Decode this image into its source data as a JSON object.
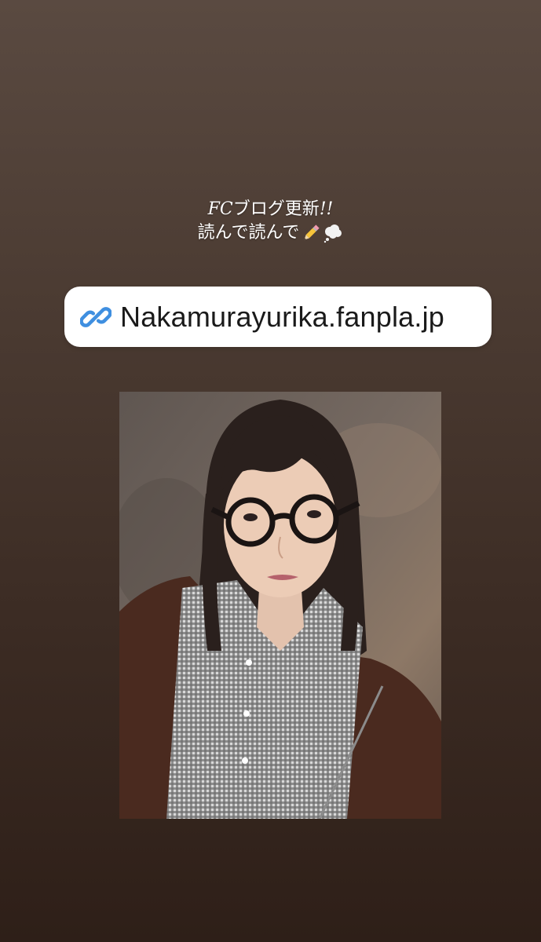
{
  "story": {
    "caption": {
      "line1_latin": "FC",
      "line1_rest": "ブログ更新",
      "line1_end": "!!",
      "line2_text": "読んで読んで",
      "emoji": [
        "pencil-icon",
        "thought-balloon-icon"
      ]
    },
    "link_sticker": {
      "url": "Nakamurayurika.fanpla.jp",
      "icon": "link-icon",
      "icon_color": "#3f8fe0"
    },
    "photo": {
      "subject": "selfie-photo"
    }
  },
  "colors": {
    "background_top": "#5a4a41",
    "background_bottom": "#2e1f18",
    "sticker_bg": "#ffffff"
  }
}
